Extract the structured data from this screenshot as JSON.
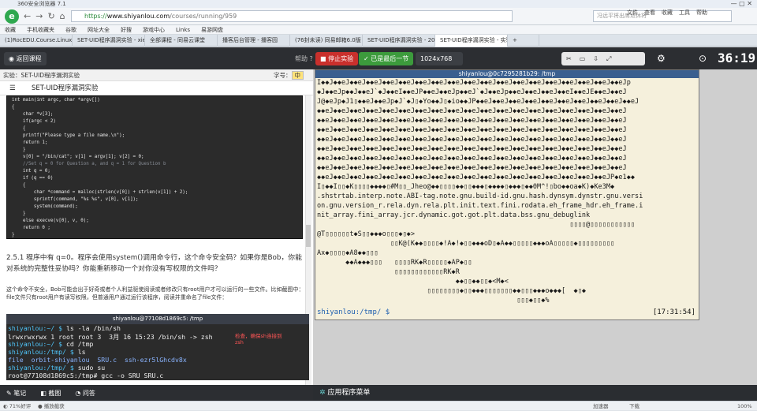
{
  "browser": {
    "title": "360安全浏览器 7.1",
    "url_prefix": "https://",
    "url_host": "www.shiyanlou.com",
    "url_path": "/courses/running/959",
    "search_placeholder": "冯远平将出席退休将",
    "menu": [
      "文件",
      "查看",
      "收藏",
      "工具",
      "帮助"
    ],
    "bookmarks": [
      "收藏",
      "手机收藏夹",
      "谷歌",
      "网址大全",
      "好搜",
      "游戏中心",
      "Links",
      "易游网盘"
    ],
    "tabs": [
      "(1)RocEDU.Course.Linux.Sec",
      "SET-UID程序漏洞实验 - xiexi",
      "全部课程 - 同易云课堂",
      "播客后台管理 - 播客园",
      "(76封未读) 同易邮箱6.0版",
      "SET-UID程序漏洞实验 - 20121",
      "SET-UID程序漏洞实验 - 实验楼",
      ""
    ],
    "tab_active_index": 6
  },
  "toolbar": {
    "back": "返回课程",
    "help": "帮助",
    "stop": "停止实验",
    "saved": "已是最后一节",
    "resolution": "1024x768",
    "timer": "36:19"
  },
  "doc": {
    "exp_label": "实验：SET-UID程序漏洞实验",
    "title": "SET-UID程序漏洞实验",
    "font_label": "字号：",
    "font_value": "中",
    "code": [
      "int main(int argc, char *argv[])",
      "{",
      "    char *v[3];",
      "    if(argc < 2)",
      "    {",
      "    printf(\"Please type a file name.\\n\");",
      "    return 1;",
      "    }",
      "    v[0] = \"/bin/cat\"; v[1] = argv[1]; v[2] = 0;",
      "    //Set q = 0 for Question a, and q = 1 for Question b",
      "    int q = 0;",
      "    if (q == 0)",
      "    {",
      "        char *command = malloc(strlen(v[0]) + strlen(v[1]) + 2);",
      "        sprintf(command, \"%s %s\", v[0], v[1]);",
      "        system(command);",
      "    }",
      "    else execve(v[0], v, 0);",
      "    return 0 ;",
      "}"
    ],
    "q_text": "2.5.1 程序中有 q=0。程序会使用system()调用命令行，这个命令安全码？如果你是Bob，你能对系统的完整性妥协吗？你能重新移动一个对你没有写权限的文件吗？",
    "note_text": "这个命令不安全，Bob可能会出于好奇或者个人利益驱使阅读或者修改只有root用户才可以运行的一些文件。比如截图中：file文件只有root用户有读写权限，但普通用户通过运行该程序，阅读并重命名了file文件：",
    "shot_title": "shiyanlou@77108d1869c5: /tmp",
    "shot_lines": [
      [
        "shiyanlou:~/ $ ",
        "ls -la /bin/sh"
      ],
      [
        "",
        "lrwxrwxrwx 1 root root 3  3月 16 15:23 /bin/sh -> zsh"
      ],
      [
        "shiyanlou:~/ $ ",
        "cd /tmp"
      ],
      [
        "shiyanlou:/tmp/ $ ",
        "ls"
      ],
      [
        "",
        "file  orbit-shiyanlou  SRU.c  ssh-ezr5lGhcdv8x"
      ],
      [
        "shiyanlou:/tmp/ $ ",
        "sudo su"
      ],
      [
        "",
        "root@77108d1869c5:/tmp# gcc -o SRU SRU.c"
      ]
    ],
    "shot_annotation": "检查，确保sh连接到zsh",
    "bottom": [
      "笔记",
      "截图",
      "问答"
    ]
  },
  "terminal": {
    "title": "shiyanlou@0c7295281b29: /tmp",
    "lines": [
      "I◆◆J◆◆eJ◆◆eJ◆◆eJ◆◆eJ◆◆eJ◆◆eJ◆◆eJ◆◆eJ◆◆eJ◆◆eJ◆◆eJ◆◆eJ◆◆eJ◆◆eJ◆◆eJ◆◆eJ◆◆eJ◆◆eJp",
      "◆J◆◆eJp◆◆J◆◆eJ`◆J◆◆eI◆◆eJP◆◆eJ◆◆eJp◆◆eJ`◆J◆◆eJp◆◆eJ◆◆eJ◆◆eJ◆◆eI◆◆eJE◆◆eJ◆◆eJ",
      "J@◆eJp◆J1▯◆◆eJ◆◆eJp◆J`◆J▯◆Yo◆◆J▯◆io◆◆JP◆◆eJ◆◆eJ◆◆eJ◆◆eJ◆◆eJ◆◆eJ◆◆eJ◆◆eJ◆◆eJ◆◆eJ",
      "◆◆eJ◆◆eJ◆◆eJ◆◆eJ◆◆eJ◆◆eJ◆◆eJ◆◆eJ◆◆eJ◆◆eJ◆◆eJ◆◆eJ◆◆eJ◆◆eJ◆◆eJ◆◆eJ◆◆eJ◆◆eJ◆◆eJ",
      "◆◆eJ◆◆eJ◆◆eJ◆◆eJ◆◆eJ◆◆eJ◆◆eJ◆◆eJ◆◆eJ◆◆eJ◆◆eJ◆◆eJ◆◆eJ◆◆eJ◆◆eJ◆◆eJ◆◆eJ◆◆eJ◆◆eJ",
      "◆◆eJ◆◆eJ◆◆eJ◆◆eJ◆◆eJ◆◆eJ◆◆eJ◆◆eJ◆◆eJ◆◆eJ◆◆eJ◆◆eJ◆◆eJ◆◆eJ◆◆eJ◆◆eJ◆◆eJ◆◆eJ◆◆eJ",
      "◆◆eJ◆◆eJ◆◆eJ◆◆eJ◆◆eJ◆◆eJ◆◆eJ◆◆eJ◆◆eJ◆◆eJ◆◆eJ◆◆eJ◆◆eJ◆◆eJ◆◆eJ◆◆eJ◆◆eJ◆◆eJ◆◆eJ",
      "◆◆eJ◆◆eJ◆◆eJ◆◆eJ◆◆eJ◆◆eJ◆◆eJ◆◆eJ◆◆eJ◆◆eJ◆◆eJ◆◆eJ◆◆eJ◆◆eJ◆◆eJ◆◆eJ◆◆eJ◆◆eJ◆◆eJ",
      "◆◆eJ◆◆eJ◆◆eJ◆◆eJ◆◆eJ◆◆eJ◆◆eJ◆◆eJ◆◆eJ◆◆eJ◆◆eJ◆◆eJ◆◆eJ◆◆eJ◆◆eJ◆◆eJ◆◆eJ◆◆eJ◆◆eJ",
      "◆◆eJ◆◆eJ◆◆eJ◆◆eJ◆◆eJ◆◆eJ◆◆eJ◆◆eJ◆◆eJ◆◆eJ◆◆eJ◆◆eJ◆◆eJ◆◆eJ◆◆eJ◆◆eJ◆◆eJ◆◆eJ◆◆eJ",
      "◆◆eJ◆◆eJ◆◆eJ◆◆eJ◆◆eJ◆◆eJ◆◆eJ◆◆eJ◆◆eJ◆◆eJ◆◆eJ◆◆eJ◆◆eJ◆◆eJ◆◆eJ◆◆eJ◆◆eJ◆◆eJP◆e1◆◆",
      "I▯◆◆I▯▯◆K▯▯▯▯◆◆◆◆▯#M▯▯_Jheo@◆◆▯▯▯▯◆◆▯▯◆◆◆▯◆◆◆◆▯◆◆◆▯◆◆0M^!▯bo◆◆oa◆K)◆Ke3M◆",
      ".shstrtab.interp.note.ABI-tag.note.gnu.build-id.gnu.hash.dynsym.dynstr.gnu.versi",
      "on.gnu.version_r.rela.dyn.rela.plt.init.text.fini.rodata.eh_frame_hdr.eh_frame.i",
      "nit_array.fini_array.jcr.dynamic.got.got.plt.data.bss.gnu_debuglink",
      "                                                              ▯▯▯▯@▯▯▯▯▯▯▯▯▯▯▯",
      "@T▯▯▯▯▯▯t◆S▯▯◆◆◆o▯▯▯◆▯◆>",
      "                  ▯▯K@(K◆◆▯▯▯▯◆!A◆!◆▯▯◆◆◆oD▯◆A◆◆▯▯▯▯▯◆◆◆oA▯▯▯▯▯◆▯▯▯▯▯▯▯▯▯",
      "Ax◆▯▯▯▯◆A8◆◆▯▯▯",
      "       ◆◆A◆◆◆▯▯▯   ▯▯▯▯RK◆R▯▯▯▯▯◆AP◆▯▯",
      "                   ▯▯▯▯▯▯▯▯▯▯▯▯RK◆R",
      "                                  ◆◆▯▯◆◆▯▯◆<M◆<",
      "                           ▯▯▯▯▯▯▯▯◆▯▯◆◆◆▯▯▯▯▯▯▯◆◆▯▯▯◆◆◆o◆◆◆[  ◆▯◆",
      "                                                 ▯▯▯◆▯▯◆%"
    ],
    "prompt_user": "shiyanlou:/tmp/ $",
    "prompt_time": "[17:31:54]"
  },
  "appmenu": "应用程序菜单",
  "status": {
    "left": "71%好评",
    "middle": "播放截获",
    "right": [
      "加速器",
      "下载",
      "",
      "",
      "100%"
    ]
  }
}
